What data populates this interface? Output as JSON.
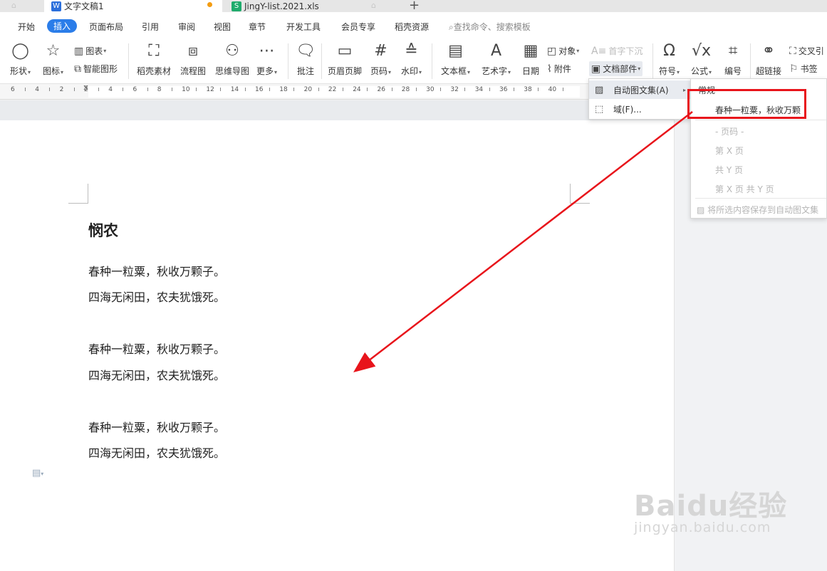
{
  "tabs": [
    {
      "name": "文字文稿1",
      "icon": "W"
    },
    {
      "name": "JingY-list.2021.xls",
      "icon": "S"
    }
  ],
  "new_tab": "+",
  "menu": {
    "items": [
      "开始",
      "插入",
      "页面布局",
      "引用",
      "审阅",
      "视图",
      "章节",
      "开发工具",
      "会员专享",
      "稻壳资源"
    ],
    "active": "插入",
    "search": "查找命令、搜索模板"
  },
  "toolbar": {
    "shape": "形状",
    "icon": "图标",
    "chart": "图表",
    "smartart": "智能图形",
    "material": "稻壳素材",
    "flowchart": "流程图",
    "mindmap": "思维导图",
    "more": "更多",
    "comment": "批注",
    "header_footer": "页眉页脚",
    "page_number": "页码",
    "watermark": "水印",
    "textbox": "文本框",
    "wordart": "艺术字",
    "date": "日期",
    "object": "对象",
    "attachment": "附件",
    "dropcap": "首字下沉",
    "doc_parts": "文档部件",
    "symbol": "符号",
    "formula": "公式",
    "numbering": "编号",
    "hyperlink": "超链接",
    "crossref": "交叉引",
    "bookmark": "书签"
  },
  "ruler": {
    "labels": [
      "6",
      "4",
      "2",
      "2",
      "4",
      "6",
      "8",
      "10",
      "12",
      "14",
      "16",
      "18",
      "20",
      "22",
      "24",
      "26",
      "28",
      "30",
      "32",
      "34",
      "36",
      "38",
      "40"
    ]
  },
  "document": {
    "title": "悯农",
    "lines": [
      "春种一粒粟，秋收万颗子。",
      "四海无闲田，农夫犹饿死。",
      "春种一粒粟，秋收万颗子。",
      "四海无闲田，农夫犹饿死。",
      "春种一粒粟，秋收万颗子。",
      "四海无闲田，农夫犹饿死。"
    ]
  },
  "doc_parts_menu": {
    "autotext": "自动图文集(A)",
    "field": "域(F)..."
  },
  "autotext_submenu": {
    "header": "常规",
    "entry": "春种一粒粟，秋收万颗",
    "page_header": "- 页码 -",
    "page_x": "第 X 页",
    "total_y": "共 Y 页",
    "page_x_total_y": "第 X 页 共 Y 页",
    "save_selection": "将所选内容保存到自动图文集"
  },
  "watermark": {
    "logo": "Baidu经验",
    "url": "jingyan.baidu.com"
  },
  "colors": {
    "accent": "#2b7de9",
    "highlight_box": "#e8141b",
    "arrow": "#e8141b"
  }
}
